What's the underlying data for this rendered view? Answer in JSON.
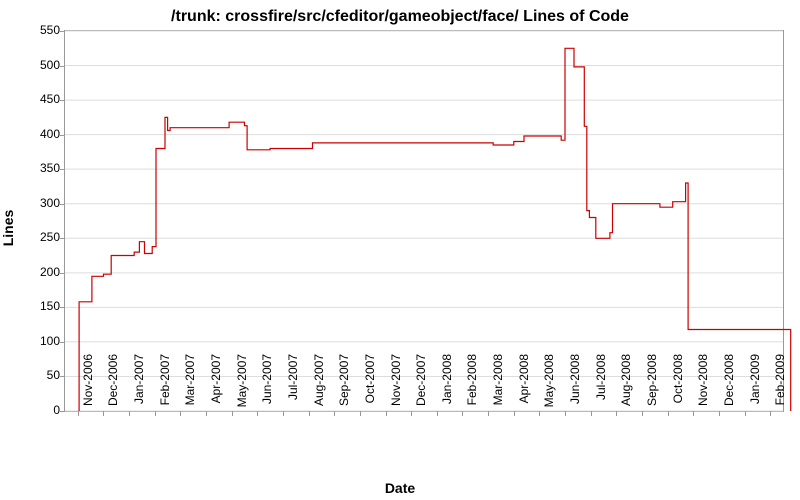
{
  "chart_data": {
    "type": "line",
    "title": "/trunk: crossfire/src/cfeditor/gameobject/face/ Lines of Code",
    "xlabel": "Date",
    "ylabel": "Lines",
    "ylim": [
      0,
      550
    ],
    "yticks": [
      0,
      50,
      100,
      150,
      200,
      250,
      300,
      350,
      400,
      450,
      500,
      550
    ],
    "categories": [
      "Nov-2006",
      "Dec-2006",
      "Jan-2007",
      "Feb-2007",
      "Mar-2007",
      "Apr-2007",
      "May-2007",
      "Jun-2007",
      "Jul-2007",
      "Aug-2007",
      "Sep-2007",
      "Oct-2007",
      "Nov-2007",
      "Dec-2007",
      "Jan-2008",
      "Feb-2008",
      "Mar-2008",
      "Apr-2008",
      "May-2008",
      "Jun-2008",
      "Jul-2008",
      "Aug-2008",
      "Sep-2008",
      "Oct-2008",
      "Nov-2008",
      "Dec-2008",
      "Jan-2009",
      "Feb-2009"
    ],
    "series": [
      {
        "name": "Lines of Code",
        "color": "#cc0000",
        "points": [
          {
            "x": 0.05,
            "y": 0
          },
          {
            "x": 0.05,
            "y": 158
          },
          {
            "x": 0.55,
            "y": 158
          },
          {
            "x": 0.55,
            "y": 195
          },
          {
            "x": 1.0,
            "y": 195
          },
          {
            "x": 1.0,
            "y": 198
          },
          {
            "x": 1.3,
            "y": 198
          },
          {
            "x": 1.3,
            "y": 225
          },
          {
            "x": 2.2,
            "y": 225
          },
          {
            "x": 2.2,
            "y": 230
          },
          {
            "x": 2.4,
            "y": 230
          },
          {
            "x": 2.4,
            "y": 245
          },
          {
            "x": 2.6,
            "y": 245
          },
          {
            "x": 2.6,
            "y": 228
          },
          {
            "x": 2.9,
            "y": 228
          },
          {
            "x": 2.9,
            "y": 238
          },
          {
            "x": 3.05,
            "y": 238
          },
          {
            "x": 3.05,
            "y": 380
          },
          {
            "x": 3.4,
            "y": 380
          },
          {
            "x": 3.4,
            "y": 425
          },
          {
            "x": 3.5,
            "y": 425
          },
          {
            "x": 3.5,
            "y": 406
          },
          {
            "x": 3.6,
            "y": 406
          },
          {
            "x": 3.6,
            "y": 410
          },
          {
            "x": 5.9,
            "y": 410
          },
          {
            "x": 5.9,
            "y": 418
          },
          {
            "x": 6.5,
            "y": 418
          },
          {
            "x": 6.5,
            "y": 413
          },
          {
            "x": 6.6,
            "y": 413
          },
          {
            "x": 6.6,
            "y": 378
          },
          {
            "x": 7.5,
            "y": 378
          },
          {
            "x": 7.5,
            "y": 380
          },
          {
            "x": 9.15,
            "y": 380
          },
          {
            "x": 9.15,
            "y": 388
          },
          {
            "x": 16.2,
            "y": 388
          },
          {
            "x": 16.2,
            "y": 385
          },
          {
            "x": 17.0,
            "y": 385
          },
          {
            "x": 17.0,
            "y": 390
          },
          {
            "x": 17.4,
            "y": 390
          },
          {
            "x": 17.4,
            "y": 398
          },
          {
            "x": 18.85,
            "y": 398
          },
          {
            "x": 18.85,
            "y": 392
          },
          {
            "x": 19.0,
            "y": 392
          },
          {
            "x": 19.0,
            "y": 525
          },
          {
            "x": 19.35,
            "y": 525
          },
          {
            "x": 19.35,
            "y": 498
          },
          {
            "x": 19.75,
            "y": 498
          },
          {
            "x": 19.75,
            "y": 412
          },
          {
            "x": 19.85,
            "y": 412
          },
          {
            "x": 19.85,
            "y": 290
          },
          {
            "x": 19.95,
            "y": 290
          },
          {
            "x": 19.95,
            "y": 280
          },
          {
            "x": 20.2,
            "y": 280
          },
          {
            "x": 20.2,
            "y": 250
          },
          {
            "x": 20.75,
            "y": 250
          },
          {
            "x": 20.75,
            "y": 258
          },
          {
            "x": 20.85,
            "y": 258
          },
          {
            "x": 20.85,
            "y": 300
          },
          {
            "x": 22.7,
            "y": 300
          },
          {
            "x": 22.7,
            "y": 295
          },
          {
            "x": 23.2,
            "y": 295
          },
          {
            "x": 23.2,
            "y": 303
          },
          {
            "x": 23.7,
            "y": 303
          },
          {
            "x": 23.7,
            "y": 330
          },
          {
            "x": 23.8,
            "y": 330
          },
          {
            "x": 23.8,
            "y": 118
          },
          {
            "x": 27.8,
            "y": 118
          },
          {
            "x": 27.8,
            "y": 0
          }
        ]
      }
    ]
  }
}
